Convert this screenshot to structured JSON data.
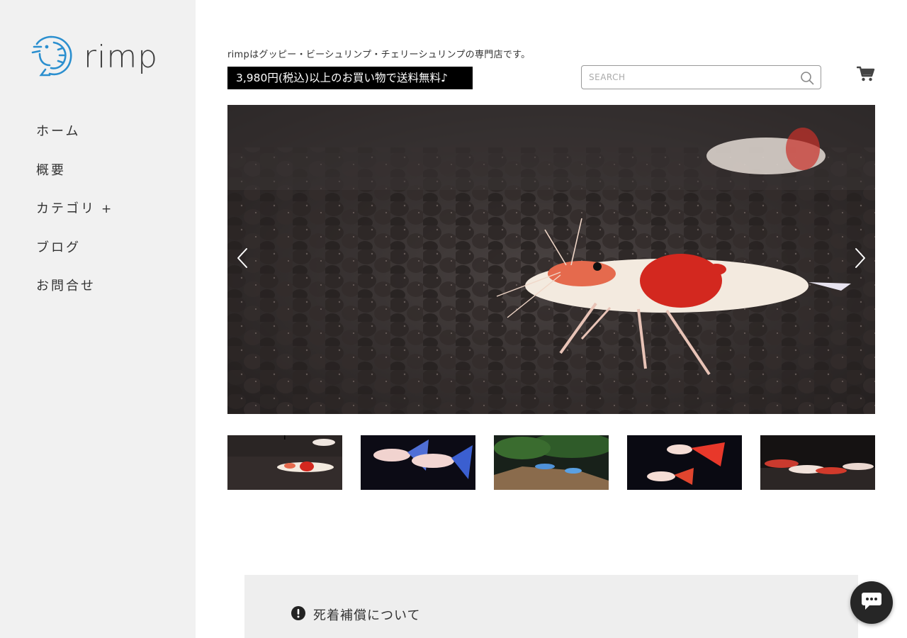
{
  "brand": {
    "name": "rimp"
  },
  "nav": {
    "items": [
      {
        "label": "ホーム"
      },
      {
        "label": "概要"
      },
      {
        "label": "カテゴリ",
        "suffix": "+"
      },
      {
        "label": "ブログ"
      },
      {
        "label": "お問合せ"
      }
    ]
  },
  "header": {
    "tagline": "rimpはグッピー・ビーシュリンプ・チェリーシュリンプの専門店です。",
    "shipping_banner": "3,980円(税込)以上のお買い物で送料無料♪"
  },
  "search": {
    "placeholder": "SEARCH",
    "value": ""
  },
  "icons": {
    "logo": "shrimp-logo-icon",
    "search": "search-icon",
    "cart": "cart-icon",
    "prev": "chevron-left-icon",
    "next": "chevron-right-icon",
    "notice": "exclamation-circle-icon",
    "chat": "chat-bubble-icon"
  },
  "slider": {
    "thumbnails": [
      {
        "subject": "red bee shrimp on gravel"
      },
      {
        "subject": "blue guppies"
      },
      {
        "subject": "blue shrimp on driftwood"
      },
      {
        "subject": "red guppies"
      },
      {
        "subject": "red bee shrimp group"
      }
    ]
  },
  "notice": {
    "title": "死着補償について"
  },
  "colors": {
    "brand_blue": "#2b8fcf",
    "sidebar_bg": "#f1f1f1",
    "banner_bg": "#000000",
    "notice_bg": "#eeeeee",
    "chat_bg": "#262626"
  }
}
